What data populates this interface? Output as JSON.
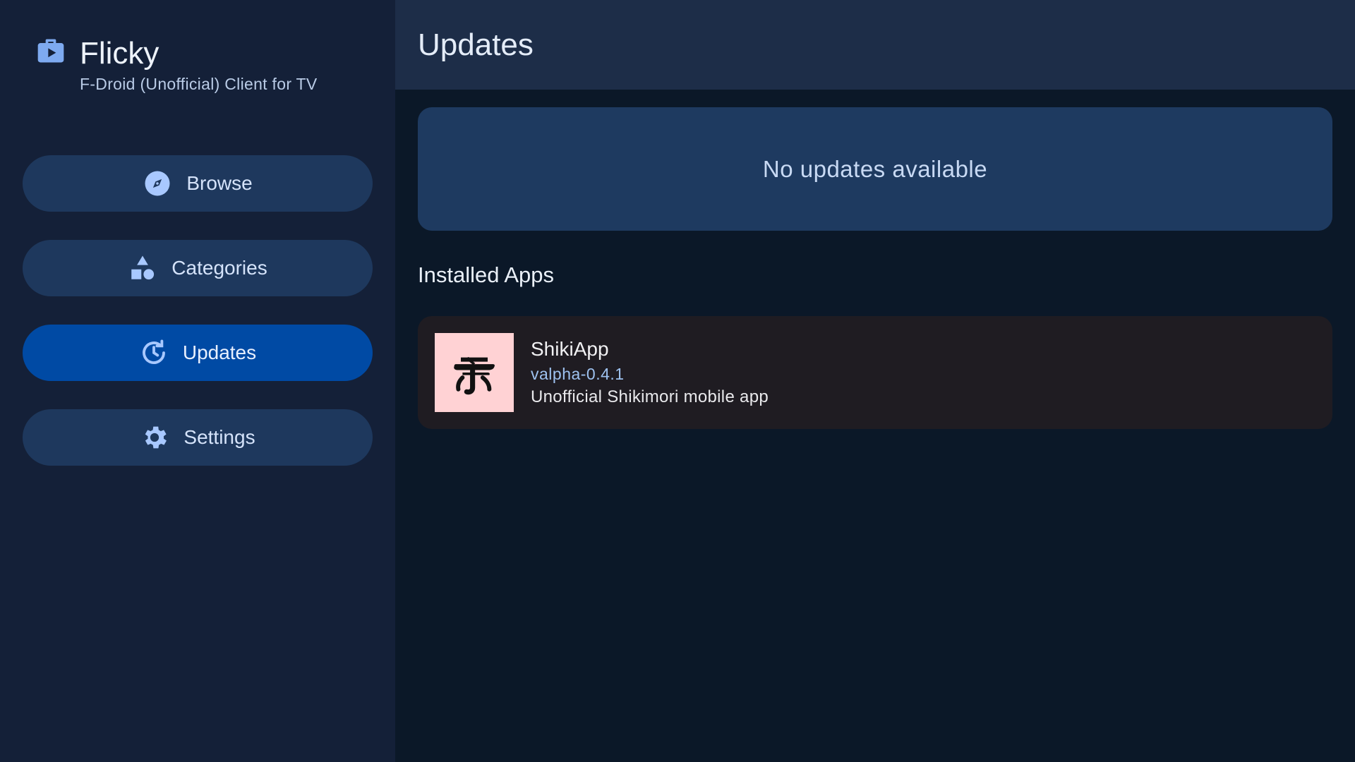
{
  "brand": {
    "title": "Flicky",
    "subtitle": "F-Droid (Unofficial) Client for TV",
    "icon": "briefcase-play-icon"
  },
  "nav": {
    "items": [
      {
        "label": "Browse",
        "icon": "compass-icon",
        "active": false
      },
      {
        "label": "Categories",
        "icon": "shapes-icon",
        "active": false
      },
      {
        "label": "Updates",
        "icon": "update-clock-icon",
        "active": true
      },
      {
        "label": "Settings",
        "icon": "gear-icon",
        "active": false
      }
    ]
  },
  "header": {
    "title": "Updates"
  },
  "updates": {
    "empty_message": "No updates available"
  },
  "installed": {
    "section_title": "Installed Apps",
    "apps": [
      {
        "name": "ShikiApp",
        "version": "valpha-0.4.1",
        "description": "Unofficial Shikimori mobile app",
        "icon": "shikiapp-logo-icon"
      }
    ]
  },
  "colors": {
    "sidebar_bg": "#142038",
    "nav_item_bg": "#1e385d",
    "nav_active_bg": "#004aa4",
    "main_bg": "#0b1828",
    "header_bg": "#1d2d48",
    "card_bg": "#1e3a60",
    "app_card_bg": "#1f1c22",
    "accent_icon": "#a8c8ff"
  }
}
